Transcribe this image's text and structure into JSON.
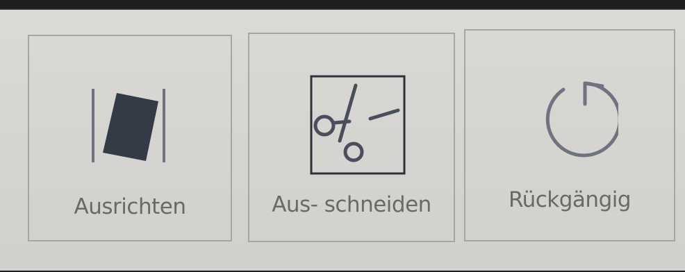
{
  "toolbar": {
    "buttons": [
      {
        "id": "align",
        "label": "Ausrichten",
        "icon": "align-icon"
      },
      {
        "id": "cut",
        "label": "Aus- schneiden",
        "icon": "scissors-icon"
      },
      {
        "id": "undo",
        "label": "Rückgängig",
        "icon": "undo-icon"
      }
    ]
  },
  "colors": {
    "background": "#d8d6d2",
    "button_border": "#a7a5a1",
    "icon_dark": "#3a3f4d",
    "icon_line": "#6f7380",
    "label_text": "#6a6966"
  }
}
